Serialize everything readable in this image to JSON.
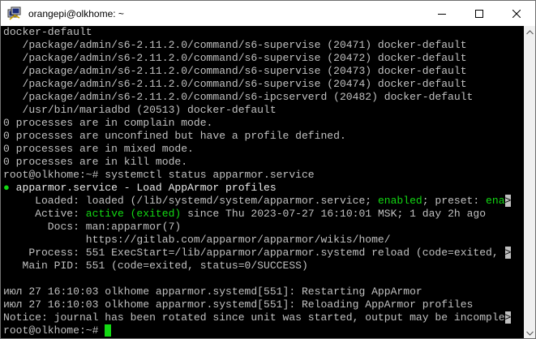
{
  "window": {
    "title": "orangepi@olkhome: ~",
    "controls": {
      "minimize_icon": "minimize-icon",
      "maximize_icon": "maximize-icon",
      "close_icon": "close-icon"
    }
  },
  "terminal": {
    "lines": [
      {
        "segments": [
          {
            "text": "docker-default"
          }
        ]
      },
      {
        "segments": [
          {
            "text": "   /package/admin/s6-2.11.2.0/command/s6-supervise (20471) docker-default"
          }
        ]
      },
      {
        "segments": [
          {
            "text": "   /package/admin/s6-2.11.2.0/command/s6-supervise (20472) docker-default"
          }
        ]
      },
      {
        "segments": [
          {
            "text": "   /package/admin/s6-2.11.2.0/command/s6-supervise (20473) docker-default"
          }
        ]
      },
      {
        "segments": [
          {
            "text": "   /package/admin/s6-2.11.2.0/command/s6-supervise (20474) docker-default"
          }
        ]
      },
      {
        "segments": [
          {
            "text": "   /package/admin/s6-2.11.2.0/command/s6-ipcserverd (20482) docker-default"
          }
        ]
      },
      {
        "segments": [
          {
            "text": "   /usr/bin/mariadbd (20513) docker-default"
          }
        ]
      },
      {
        "segments": [
          {
            "text": "0 processes are in complain mode."
          }
        ]
      },
      {
        "segments": [
          {
            "text": "0 processes are unconfined but have a profile defined."
          }
        ]
      },
      {
        "segments": [
          {
            "text": "0 processes are in mixed mode."
          }
        ]
      },
      {
        "segments": [
          {
            "text": "0 processes are in kill mode."
          }
        ]
      },
      {
        "segments": [
          {
            "text": "root@olkhome:~# systemctl status apparmor.service"
          }
        ]
      },
      {
        "segments": [
          {
            "text": "●",
            "style": "g"
          },
          {
            "text": " apparmor.service - Load AppArmor profiles",
            "style": "w"
          }
        ]
      },
      {
        "segments": [
          {
            "text": "     Loaded: loaded (/lib/systemd/system/apparmor.service; "
          },
          {
            "text": "enabled",
            "style": "g"
          },
          {
            "text": "; preset: "
          },
          {
            "text": "ena",
            "style": "g"
          }
        ],
        "truncated": true
      },
      {
        "segments": [
          {
            "text": "     Active: "
          },
          {
            "text": "active (exited)",
            "style": "g"
          },
          {
            "text": " since Thu 2023-07-27 16:10:01 MSK; 1 day 2h ago"
          }
        ]
      },
      {
        "segments": [
          {
            "text": "       Docs: man:apparmor(7)"
          }
        ]
      },
      {
        "segments": [
          {
            "text": "             https://gitlab.com/apparmor/apparmor/wikis/home/"
          }
        ]
      },
      {
        "segments": [
          {
            "text": "    Process: 551 ExecStart=/lib/apparmor/apparmor.systemd reload (code=exited, "
          }
        ],
        "truncated": true
      },
      {
        "segments": [
          {
            "text": "   Main PID: 551 (code=exited, status=0/SUCCESS)"
          }
        ]
      },
      {
        "segments": [
          {
            "text": ""
          }
        ]
      },
      {
        "segments": [
          {
            "text": "июл 27 16:10:03 olkhome apparmor.systemd[551]: Restarting AppArmor"
          }
        ]
      },
      {
        "segments": [
          {
            "text": "июл 27 16:10:03 olkhome apparmor.systemd[551]: Reloading AppArmor profiles"
          }
        ]
      },
      {
        "segments": [
          {
            "text": "Notice: journal has been rotated since unit was started, output may be incomple"
          }
        ],
        "truncated": true
      },
      {
        "segments": [
          {
            "text": "root@olkhome:~# "
          }
        ],
        "cursor": true
      }
    ],
    "truncation_marker": ">"
  },
  "colors": {
    "background": "#000000",
    "text": "#c0c0c0",
    "green": "#13d813"
  },
  "scrollbar": {
    "up_icon": "scroll-up-icon",
    "down_icon": "scroll-down-icon"
  }
}
